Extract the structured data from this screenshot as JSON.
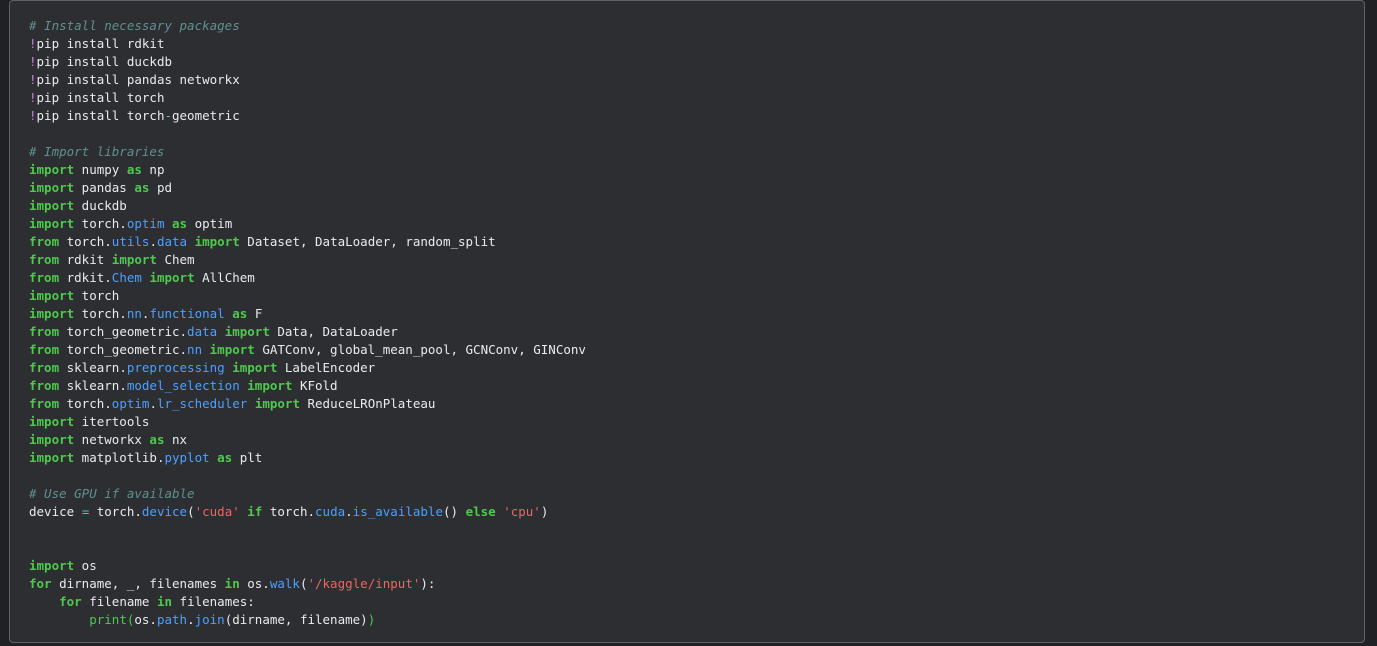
{
  "cell": {
    "lines": [
      [
        {
          "t": "# Install necessary packages",
          "c": "comment"
        }
      ],
      [
        {
          "t": "!",
          "c": "bang"
        },
        {
          "t": "pip install rdkit",
          "c": "text"
        }
      ],
      [
        {
          "t": "!",
          "c": "bang"
        },
        {
          "t": "pip install duckdb",
          "c": "text"
        }
      ],
      [
        {
          "t": "!",
          "c": "bang"
        },
        {
          "t": "pip install pandas networkx",
          "c": "text"
        }
      ],
      [
        {
          "t": "!",
          "c": "bang"
        },
        {
          "t": "pip install torch",
          "c": "text"
        }
      ],
      [
        {
          "t": "!",
          "c": "bang"
        },
        {
          "t": "pip install torch",
          "c": "text"
        },
        {
          "t": "-",
          "c": "op"
        },
        {
          "t": "geometric",
          "c": "text"
        }
      ],
      [],
      [
        {
          "t": "# Import libraries",
          "c": "comment"
        }
      ],
      [
        {
          "t": "import",
          "c": "kw"
        },
        {
          "t": " numpy ",
          "c": "text"
        },
        {
          "t": "as",
          "c": "kw"
        },
        {
          "t": " np",
          "c": "text"
        }
      ],
      [
        {
          "t": "import",
          "c": "kw"
        },
        {
          "t": " pandas ",
          "c": "text"
        },
        {
          "t": "as",
          "c": "kw"
        },
        {
          "t": " pd",
          "c": "text"
        }
      ],
      [
        {
          "t": "import",
          "c": "kw"
        },
        {
          "t": " duckdb",
          "c": "text"
        }
      ],
      [
        {
          "t": "import",
          "c": "kw"
        },
        {
          "t": " torch.",
          "c": "text"
        },
        {
          "t": "optim",
          "c": "mod"
        },
        {
          "t": " ",
          "c": "text"
        },
        {
          "t": "as",
          "c": "kw"
        },
        {
          "t": " optim",
          "c": "text"
        }
      ],
      [
        {
          "t": "from",
          "c": "kw"
        },
        {
          "t": " torch.",
          "c": "text"
        },
        {
          "t": "utils",
          "c": "mod"
        },
        {
          "t": ".",
          "c": "text"
        },
        {
          "t": "data",
          "c": "mod"
        },
        {
          "t": " ",
          "c": "text"
        },
        {
          "t": "import",
          "c": "kw"
        },
        {
          "t": " Dataset, DataLoader, random_split",
          "c": "text"
        }
      ],
      [
        {
          "t": "from",
          "c": "kw"
        },
        {
          "t": " rdkit ",
          "c": "text"
        },
        {
          "t": "import",
          "c": "kw"
        },
        {
          "t": " Chem",
          "c": "text"
        }
      ],
      [
        {
          "t": "from",
          "c": "kw"
        },
        {
          "t": " rdkit.",
          "c": "text"
        },
        {
          "t": "Chem",
          "c": "mod"
        },
        {
          "t": " ",
          "c": "text"
        },
        {
          "t": "import",
          "c": "kw"
        },
        {
          "t": " AllChem",
          "c": "text"
        }
      ],
      [
        {
          "t": "import",
          "c": "kw"
        },
        {
          "t": " torch",
          "c": "text"
        }
      ],
      [
        {
          "t": "import",
          "c": "kw"
        },
        {
          "t": " torch.",
          "c": "text"
        },
        {
          "t": "nn",
          "c": "mod"
        },
        {
          "t": ".",
          "c": "text"
        },
        {
          "t": "functional",
          "c": "mod"
        },
        {
          "t": " ",
          "c": "text"
        },
        {
          "t": "as",
          "c": "kw"
        },
        {
          "t": " F",
          "c": "text"
        }
      ],
      [
        {
          "t": "from",
          "c": "kw"
        },
        {
          "t": " torch_geometric.",
          "c": "text"
        },
        {
          "t": "data",
          "c": "mod"
        },
        {
          "t": " ",
          "c": "text"
        },
        {
          "t": "import",
          "c": "kw"
        },
        {
          "t": " Data, DataLoader",
          "c": "text"
        }
      ],
      [
        {
          "t": "from",
          "c": "kw"
        },
        {
          "t": " torch_geometric.",
          "c": "text"
        },
        {
          "t": "nn",
          "c": "mod"
        },
        {
          "t": " ",
          "c": "text"
        },
        {
          "t": "import",
          "c": "kw"
        },
        {
          "t": " GATConv, global_mean_pool, GCNConv, GINConv",
          "c": "text"
        }
      ],
      [
        {
          "t": "from",
          "c": "kw"
        },
        {
          "t": " sklearn.",
          "c": "text"
        },
        {
          "t": "preprocessing",
          "c": "mod"
        },
        {
          "t": " ",
          "c": "text"
        },
        {
          "t": "import",
          "c": "kw"
        },
        {
          "t": " LabelEncoder",
          "c": "text"
        }
      ],
      [
        {
          "t": "from",
          "c": "kw"
        },
        {
          "t": " sklearn.",
          "c": "text"
        },
        {
          "t": "model_selection",
          "c": "mod"
        },
        {
          "t": " ",
          "c": "text"
        },
        {
          "t": "import",
          "c": "kw"
        },
        {
          "t": " KFold",
          "c": "text"
        }
      ],
      [
        {
          "t": "from",
          "c": "kw"
        },
        {
          "t": " torch.",
          "c": "text"
        },
        {
          "t": "optim",
          "c": "mod"
        },
        {
          "t": ".",
          "c": "text"
        },
        {
          "t": "lr_scheduler",
          "c": "mod"
        },
        {
          "t": " ",
          "c": "text"
        },
        {
          "t": "import",
          "c": "kw"
        },
        {
          "t": " ReduceLROnPlateau",
          "c": "text"
        }
      ],
      [
        {
          "t": "import",
          "c": "kw"
        },
        {
          "t": " itertools",
          "c": "text"
        }
      ],
      [
        {
          "t": "import",
          "c": "kw"
        },
        {
          "t": " networkx ",
          "c": "text"
        },
        {
          "t": "as",
          "c": "kw"
        },
        {
          "t": " nx",
          "c": "text"
        }
      ],
      [
        {
          "t": "import",
          "c": "kw"
        },
        {
          "t": " matplotlib.",
          "c": "text"
        },
        {
          "t": "pyplot",
          "c": "mod"
        },
        {
          "t": " ",
          "c": "text"
        },
        {
          "t": "as",
          "c": "kw"
        },
        {
          "t": " plt",
          "c": "text"
        }
      ],
      [],
      [
        {
          "t": "# Use GPU if available",
          "c": "comment"
        }
      ],
      [
        {
          "t": "device ",
          "c": "text"
        },
        {
          "t": "=",
          "c": "op"
        },
        {
          "t": " torch.",
          "c": "text"
        },
        {
          "t": "device",
          "c": "fn"
        },
        {
          "t": "(",
          "c": "text"
        },
        {
          "t": "'cuda'",
          "c": "str"
        },
        {
          "t": " ",
          "c": "text"
        },
        {
          "t": "if",
          "c": "kw"
        },
        {
          "t": " torch.",
          "c": "text"
        },
        {
          "t": "cuda",
          "c": "mod"
        },
        {
          "t": ".",
          "c": "text"
        },
        {
          "t": "is_available",
          "c": "fn"
        },
        {
          "t": "() ",
          "c": "text"
        },
        {
          "t": "else",
          "c": "kw"
        },
        {
          "t": " ",
          "c": "text"
        },
        {
          "t": "'cpu'",
          "c": "str"
        },
        {
          "t": ")",
          "c": "text"
        }
      ],
      [],
      [],
      [
        {
          "t": "import",
          "c": "kw"
        },
        {
          "t": " os",
          "c": "text"
        }
      ],
      [
        {
          "t": "for",
          "c": "kw"
        },
        {
          "t": " dirname, _, filenames ",
          "c": "text"
        },
        {
          "t": "in",
          "c": "kw"
        },
        {
          "t": " os.",
          "c": "text"
        },
        {
          "t": "walk",
          "c": "fn"
        },
        {
          "t": "(",
          "c": "text"
        },
        {
          "t": "'/kaggle/input'",
          "c": "str"
        },
        {
          "t": "):",
          "c": "text"
        }
      ],
      [
        {
          "t": "    ",
          "c": "text"
        },
        {
          "t": "for",
          "c": "kw"
        },
        {
          "t": " filename ",
          "c": "text"
        },
        {
          "t": "in",
          "c": "kw"
        },
        {
          "t": " filenames:",
          "c": "text"
        }
      ],
      [
        {
          "t": "        ",
          "c": "text"
        },
        {
          "t": "print(",
          "c": "builtin"
        },
        {
          "t": "os.",
          "c": "text"
        },
        {
          "t": "path",
          "c": "mod"
        },
        {
          "t": ".",
          "c": "text"
        },
        {
          "t": "join",
          "c": "fn"
        },
        {
          "t": "(dirname, filename)",
          "c": "text"
        },
        {
          "t": ")",
          "c": "builtin"
        }
      ]
    ]
  },
  "colors": {
    "background": "#202124",
    "cell_background": "#2d2e31",
    "comment": "#5f8f8f",
    "keyword": "#4ec94e",
    "module": "#4d9fff",
    "string": "#f06363",
    "bang": "#c678dd",
    "text": "#e8eaed"
  }
}
